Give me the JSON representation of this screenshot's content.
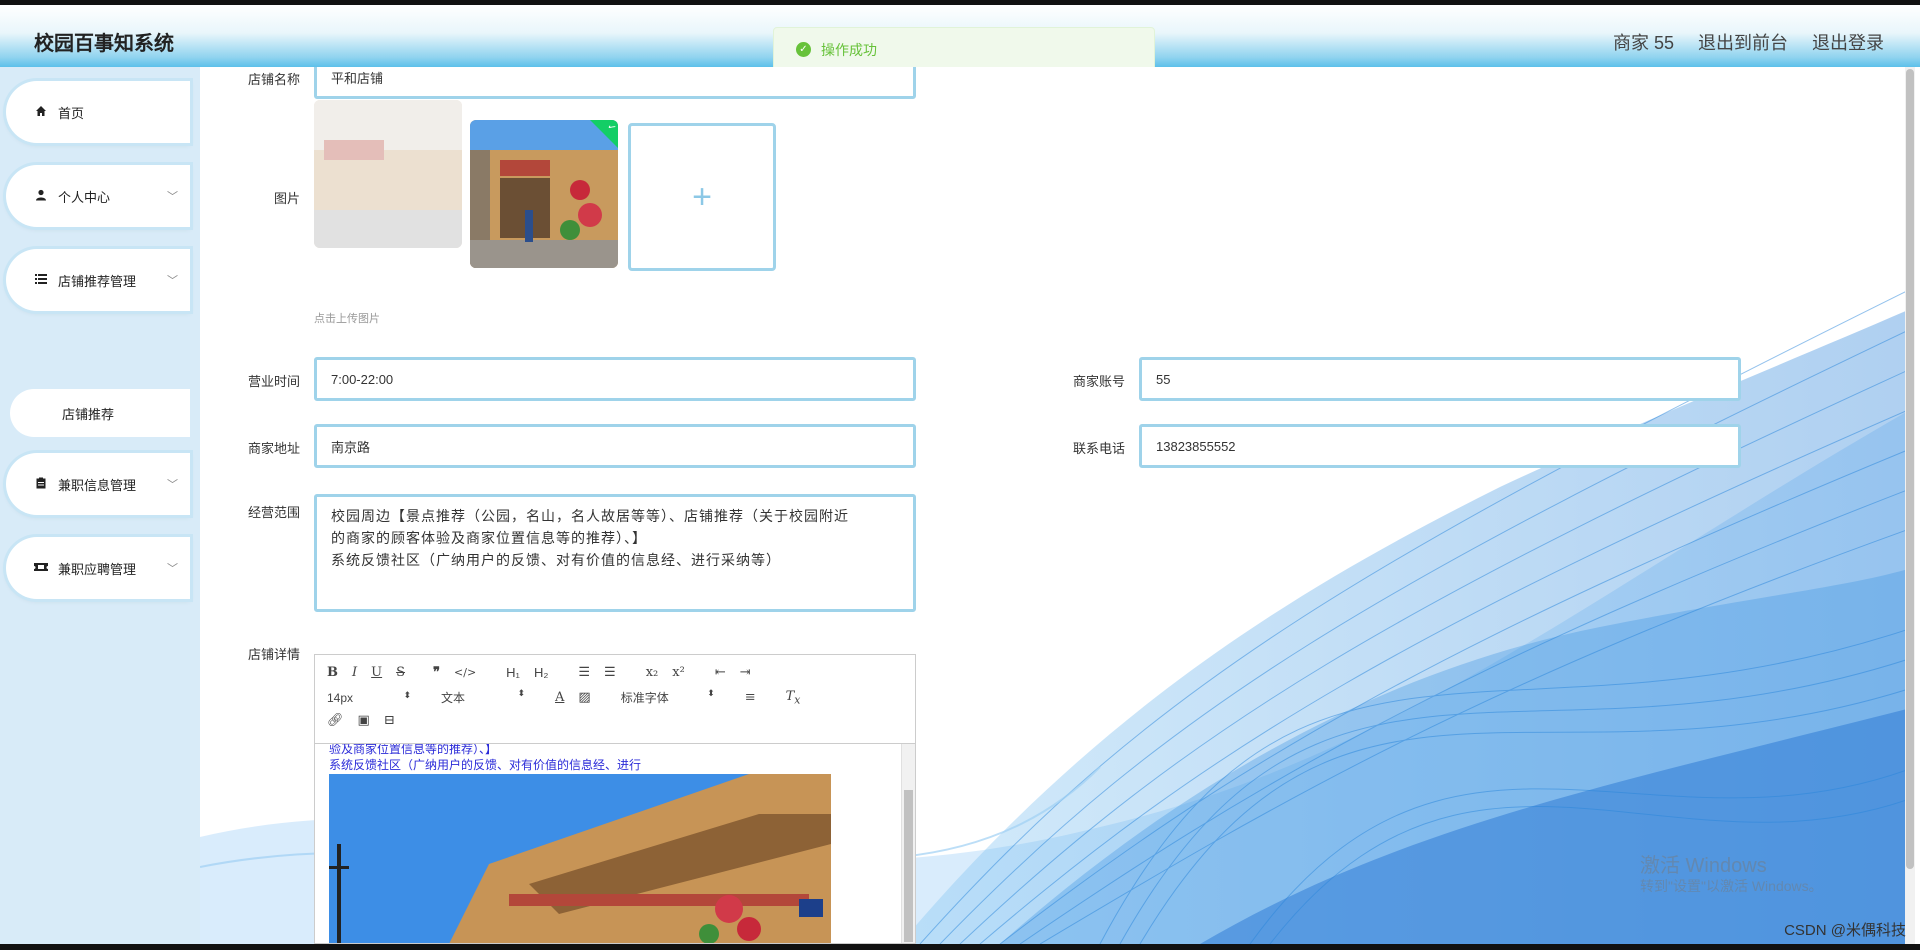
{
  "header": {
    "brand": "校园百事知系统",
    "user": "商家 55",
    "to_frontend": "退出到前台",
    "logout": "退出登录"
  },
  "toast": {
    "message": "操作成功"
  },
  "sidebar": {
    "items": [
      {
        "label": "首页",
        "icon": "home-icon"
      },
      {
        "label": "个人中心",
        "icon": "user-icon"
      },
      {
        "label": "店铺推荐管理",
        "icon": "list-icon"
      },
      {
        "label": "兼职信息管理",
        "icon": "clipboard-icon"
      },
      {
        "label": "兼职应聘管理",
        "icon": "ticket-icon"
      }
    ],
    "sub_item": "店铺推荐"
  },
  "form": {
    "shop_name_label": "店铺名称",
    "shop_name_value": "平和店铺",
    "image_label": "图片",
    "upload_hint": "点击上传图片",
    "hours_label": "营业时间",
    "hours_value": "7:00-22:00",
    "account_label": "商家账号",
    "account_value": "55",
    "address_label": "商家地址",
    "address_value": "南京路",
    "phone_label": "联系电话",
    "phone_value": "13823855552",
    "scope_label": "经营范围",
    "scope_line1": "校园周边【景点推荐（公园，名山，名人故居等等）、店铺推荐（关于校园附近",
    "scope_line2": "的商家的顾客体验及商家位置信息等的推荐）、】",
    "scope_line3": "系统反馈社区（广纳用户的反馈、对有价值的信息经、进行采纳等）",
    "detail_label": "店铺详情"
  },
  "editor": {
    "font_size": "14px",
    "block_type": "文本",
    "font_family": "标准字体",
    "line1": "验及商家位置信息等的推荐）、】",
    "line2": "系统反馈社区（广纳用户的反馈、对有价值的信息经、进行"
  },
  "overlay": {
    "activate_title": "激活 Windows",
    "activate_sub": "转到\"设置\"以激活 Windows。",
    "credit": "CSDN @米偶科技"
  }
}
